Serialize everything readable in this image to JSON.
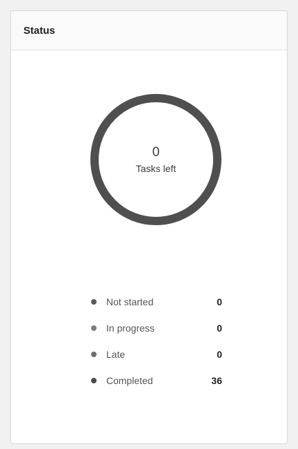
{
  "card": {
    "title": "Status"
  },
  "summary": {
    "count": "0",
    "label": "Tasks left",
    "ring_color": "#4f4f4f"
  },
  "legend": [
    {
      "label": "Not started",
      "value": "0",
      "color": "#5a5a5a"
    },
    {
      "label": "In progress",
      "value": "0",
      "color": "#7d7d7d"
    },
    {
      "label": "Late",
      "value": "0",
      "color": "#6e6e6e"
    },
    {
      "label": "Completed",
      "value": "36",
      "color": "#4a4a4a"
    }
  ]
}
